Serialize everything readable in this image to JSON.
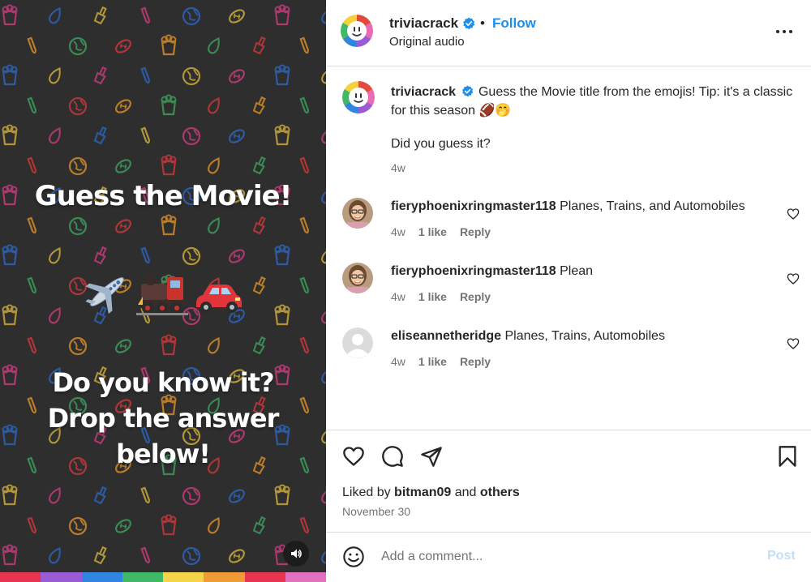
{
  "media": {
    "title": "Guess the Movie!",
    "subtitle": "Do you know it? Drop the answer below!",
    "emojis": [
      "airplane-emoji",
      "locomotive-emoji",
      "car-emoji"
    ],
    "rainbow_colors": [
      "#e8344e",
      "#9b5bd6",
      "#2f86e0",
      "#3fb868",
      "#f6d44a",
      "#f19a38",
      "#e8344e",
      "#e26fc0"
    ]
  },
  "header": {
    "username": "triviacrack",
    "separator": "•",
    "follow_label": "Follow",
    "audio_label": "Original audio"
  },
  "caption": {
    "username": "triviacrack",
    "text": "Guess the Movie title from the emojis! Tip: it's a classic for this season 🏈🤭",
    "question": "Did you guess it?",
    "time": "4w"
  },
  "comments": [
    {
      "username": "fieryphoenixringmaster118",
      "text": "Planes, Trains, and Automobiles",
      "time": "4w",
      "likes": "1 like",
      "reply": "Reply"
    },
    {
      "username": "fieryphoenixringmaster118",
      "text": "Plean",
      "time": "4w",
      "likes": "1 like",
      "reply": "Reply"
    },
    {
      "username": "eliseannetheridge",
      "text": "Planes, Trains, Automobiles",
      "time": "4w",
      "likes": "1 like",
      "reply": "Reply"
    }
  ],
  "likes": {
    "prefix": "Liked by",
    "user": "bitman09",
    "conj": "and",
    "others": "others"
  },
  "date": "November 30",
  "comment_bar": {
    "placeholder": "Add a comment...",
    "post_label": "Post"
  },
  "colors": {
    "follow": "#1b8ff0",
    "verified": "#1b8ff0",
    "media_bg": "#2e2e2e",
    "post_disabled": "#c0dffd"
  }
}
